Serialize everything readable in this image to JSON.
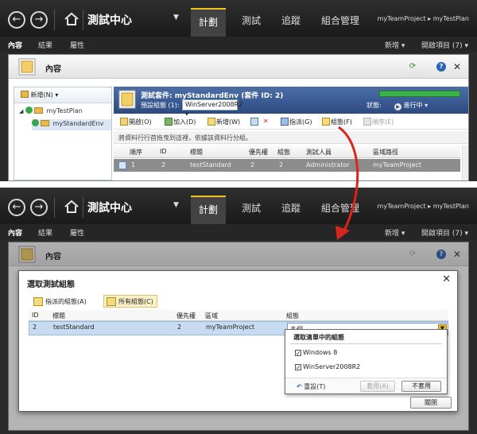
{
  "window": {
    "app_title": "測試中心",
    "tabs": [
      "計劃",
      "測試",
      "追蹤",
      "組合管理"
    ],
    "project_path": "myTeamProject ▸ myTestPlan",
    "subnav": {
      "items": [
        "內容",
        "結果",
        "屬性"
      ],
      "new_label": "新增 ▾",
      "open_label": "開啟項目 (7) ▾"
    }
  },
  "content": {
    "title": "內容"
  },
  "tree": {
    "new_label": "新增(N)",
    "items": [
      "myTestPlan",
      "myStandardEnv"
    ]
  },
  "suite": {
    "name": "測試套件:  myStandardEnv (套件 ID: 2)",
    "config_label": "預設組態 (1):",
    "config_value": "WinServer2008R2",
    "state_label": "狀態:",
    "state_value": "進行中 ▾",
    "progress": 1.0
  },
  "toolbar": {
    "items": [
      "開啟(O)",
      "加入(D)",
      "新增(W)",
      "指派(G)",
      "組態(F)",
      "順序(E)"
    ]
  },
  "hint": "將資料行行首拖曳到這裡，依據該資料行分組。",
  "grid": {
    "columns": [
      "順序",
      "ID",
      "標題",
      "優先權",
      "組態",
      "測試人員",
      "區域路徑"
    ],
    "row": [
      "1",
      "2",
      "testStandard",
      "2",
      "2",
      "Administrator",
      "myTeamProject"
    ]
  },
  "dialog": {
    "title": "選取測試組態",
    "tabs": [
      "指派的組態(A)",
      "所有組態(C)"
    ],
    "columns": [
      "ID",
      "標題",
      "優先權",
      "區域",
      "組態"
    ],
    "row": [
      "2",
      "testStandard",
      "2",
      "myTeamProject"
    ],
    "combo_value": "多個",
    "dropdown": {
      "header": "選取清單中的組態",
      "options": [
        {
          "label": "Windows 8",
          "checked": true
        },
        {
          "label": "WinServer2008R2",
          "checked": true
        }
      ],
      "reset_label": "重設(T)",
      "apply_label": "套用(A)",
      "cancel_label": "不套用"
    },
    "close_label": "關閉"
  },
  "colors": {
    "accent": "#f0c419",
    "chrome": "#2b2b2b",
    "suite_header": "#2c4a80",
    "arrow": "#d9261c",
    "progress": "#3bb54a"
  },
  "icons": [
    "back-icon",
    "forward-icon",
    "home-icon",
    "help-icon",
    "close-icon",
    "refresh-icon"
  ]
}
